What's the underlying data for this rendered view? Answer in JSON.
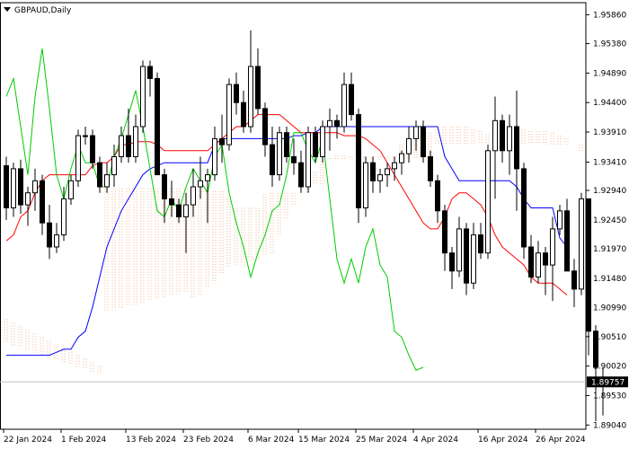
{
  "chart_data": {
    "type": "candlestick",
    "title": "GBPAUD,Daily",
    "current_price": "1.89757",
    "y_ticks": [
      "1.95860",
      "1.95380",
      "1.94890",
      "1.94400",
      "1.93910",
      "1.93410",
      "1.92940",
      "1.92450",
      "1.91970",
      "1.91480",
      "1.90990",
      "1.90510",
      "1.90020",
      "1.89530",
      "1.89040"
    ],
    "x_ticks": [
      "22 Jan 2024",
      "1 Feb 2024",
      "13 Feb 2024",
      "23 Feb 2024",
      "6 Mar 2024",
      "15 Mar 2024",
      "25 Mar 2024",
      "4 Apr 2024",
      "16 Apr 2024",
      "26 Apr 2024"
    ],
    "ylim": [
      1.8897,
      1.9606
    ],
    "grid": false,
    "colors": {
      "candle_body": "#000000",
      "candle_up_fill": "#ffffff",
      "tenkan_sen": "#ff0000",
      "kijun_sen": "#0000ff",
      "chikou_span": "#00cc00",
      "kumo": "#e8a070",
      "price_line": "#c0c0c0"
    },
    "candles": [
      [
        1.9335,
        1.935,
        1.9245,
        1.9265
      ],
      [
        1.9265,
        1.934,
        1.925,
        1.933
      ],
      [
        1.933,
        1.9345,
        1.9255,
        1.927
      ],
      [
        1.927,
        1.93,
        1.9235,
        1.929
      ],
      [
        1.929,
        1.933,
        1.926,
        1.931
      ],
      [
        1.931,
        1.932,
        1.922,
        1.924
      ],
      [
        1.924,
        1.927,
        1.918,
        1.92
      ],
      [
        1.92,
        1.924,
        1.919,
        1.922
      ],
      [
        1.922,
        1.93,
        1.921,
        1.928
      ],
      [
        1.928,
        1.932,
        1.927,
        1.931
      ],
      [
        1.931,
        1.9395,
        1.93,
        1.9385
      ],
      [
        1.9385,
        1.94,
        1.937,
        1.9385
      ],
      [
        1.9385,
        1.9395,
        1.933,
        1.934
      ],
      [
        1.934,
        1.935,
        1.929,
        1.93
      ],
      [
        1.93,
        1.934,
        1.929,
        1.932
      ],
      [
        1.932,
        1.937,
        1.93,
        1.935
      ],
      [
        1.935,
        1.94,
        1.934,
        1.9385
      ],
      [
        1.9385,
        1.943,
        1.934,
        1.935
      ],
      [
        1.935,
        1.942,
        1.934,
        1.94
      ],
      [
        1.94,
        1.951,
        1.939,
        1.95
      ],
      [
        1.95,
        1.951,
        1.945,
        1.948
      ],
      [
        1.948,
        1.949,
        1.934,
        1.932
      ],
      [
        1.932,
        1.933,
        1.924,
        1.928
      ],
      [
        1.928,
        1.931,
        1.925,
        1.927
      ],
      [
        1.927,
        1.928,
        1.924,
        1.925
      ],
      [
        1.925,
        1.929,
        1.919,
        1.927
      ],
      [
        1.927,
        1.933,
        1.925,
        1.93
      ],
      [
        1.93,
        1.935,
        1.928,
        1.931
      ],
      [
        1.931,
        1.933,
        1.924,
        1.932
      ],
      [
        1.932,
        1.94,
        1.931,
        1.938
      ],
      [
        1.938,
        1.942,
        1.934,
        1.937
      ],
      [
        1.937,
        1.948,
        1.936,
        1.947
      ],
      [
        1.947,
        1.949,
        1.942,
        1.944
      ],
      [
        1.944,
        1.946,
        1.939,
        1.94
      ],
      [
        1.94,
        1.956,
        1.939,
        1.95
      ],
      [
        1.95,
        1.953,
        1.942,
        1.943
      ],
      [
        1.943,
        1.944,
        1.935,
        1.937
      ],
      [
        1.937,
        1.94,
        1.93,
        1.932
      ],
      [
        1.932,
        1.94,
        1.931,
        1.939
      ],
      [
        1.939,
        1.94,
        1.934,
        1.935
      ],
      [
        1.935,
        1.938,
        1.932,
        1.934
      ],
      [
        1.934,
        1.936,
        1.929,
        1.93
      ],
      [
        1.93,
        1.94,
        1.929,
        1.939
      ],
      [
        1.939,
        1.94,
        1.934,
        1.935
      ],
      [
        1.935,
        1.941,
        1.934,
        1.94
      ],
      [
        1.94,
        1.943,
        1.936,
        1.941
      ],
      [
        1.941,
        1.942,
        1.938,
        1.94
      ],
      [
        1.94,
        1.949,
        1.939,
        1.947
      ],
      [
        1.947,
        1.949,
        1.941,
        1.942
      ],
      [
        1.942,
        1.943,
        1.924,
        1.9265
      ],
      [
        1.9265,
        1.935,
        1.925,
        1.934
      ],
      [
        1.934,
        1.935,
        1.929,
        1.931
      ],
      [
        1.931,
        1.933,
        1.929,
        1.932
      ],
      [
        1.932,
        1.934,
        1.93,
        1.933
      ],
      [
        1.933,
        1.935,
        1.931,
        1.934
      ],
      [
        1.934,
        1.936,
        1.932,
        1.9355
      ],
      [
        1.9355,
        1.94,
        1.934,
        1.938
      ],
      [
        1.938,
        1.941,
        1.936,
        1.94
      ],
      [
        1.94,
        1.941,
        1.934,
        1.935
      ],
      [
        1.935,
        1.936,
        1.93,
        1.931
      ],
      [
        1.931,
        1.932,
        1.924,
        1.926
      ],
      [
        1.926,
        1.927,
        1.916,
        1.919
      ],
      [
        1.919,
        1.92,
        1.913,
        1.916
      ],
      [
        1.916,
        1.925,
        1.915,
        1.923
      ],
      [
        1.923,
        1.924,
        1.912,
        1.914
      ],
      [
        1.914,
        1.924,
        1.913,
        1.922
      ],
      [
        1.922,
        1.924,
        1.918,
        1.919
      ],
      [
        1.919,
        1.937,
        1.918,
        1.936
      ],
      [
        1.936,
        1.945,
        1.928,
        1.941
      ],
      [
        1.941,
        1.942,
        1.934,
        1.936
      ],
      [
        1.936,
        1.942,
        1.932,
        1.94
      ],
      [
        1.94,
        1.946,
        1.926,
        1.933
      ],
      [
        1.933,
        1.934,
        1.918,
        1.92
      ],
      [
        1.92,
        1.922,
        1.914,
        1.915
      ],
      [
        1.915,
        1.921,
        1.914,
        1.919
      ],
      [
        1.919,
        1.92,
        1.912,
        1.917
      ],
      [
        1.917,
        1.925,
        1.911,
        1.923
      ],
      [
        1.923,
        1.927,
        1.922,
        1.926
      ],
      [
        1.926,
        1.928,
        1.916,
        1.916
      ],
      [
        1.916,
        1.918,
        1.91,
        1.913
      ],
      [
        1.913,
        1.929,
        1.912,
        1.928
      ],
      [
        1.928,
        1.925,
        1.902,
        1.906
      ],
      [
        1.906,
        1.907,
        1.891,
        1.9
      ],
      [
        1.897,
        1.9,
        1.892,
        1.8977
      ]
    ],
    "tenkan_sen": [
      1.921,
      1.922,
      1.925,
      1.926,
      1.929,
      1.931,
      1.932,
      1.932,
      1.932,
      1.932,
      1.932,
      1.932,
      1.9335,
      1.934,
      1.934,
      1.935,
      1.937,
      1.937,
      1.9375,
      1.9375,
      1.9375,
      1.937,
      1.936,
      1.936,
      1.936,
      1.936,
      1.936,
      1.936,
      1.936,
      1.937,
      1.938,
      1.939,
      1.94,
      1.94,
      1.941,
      1.942,
      1.942,
      1.942,
      1.942,
      1.941,
      1.94,
      1.939,
      1.939,
      1.939,
      1.939,
      1.939,
      1.939,
      1.9385,
      1.9385,
      1.9385,
      1.938,
      1.937,
      1.936,
      1.934,
      1.932,
      1.93,
      1.928,
      1.926,
      1.924,
      1.923,
      1.923,
      1.925,
      1.928,
      1.929,
      1.929,
      1.928,
      1.927,
      1.925,
      1.922,
      1.92,
      1.919,
      1.918,
      1.917,
      1.915,
      1.914,
      1.914,
      1.914,
      1.913,
      1.912
    ],
    "kijun_sen": [
      1.902,
      1.902,
      1.902,
      1.902,
      1.902,
      1.902,
      1.902,
      1.9025,
      1.903,
      1.903,
      1.905,
      1.906,
      1.91,
      1.915,
      1.92,
      1.923,
      1.926,
      1.928,
      1.93,
      1.932,
      1.933,
      1.9335,
      1.934,
      1.934,
      1.934,
      1.934,
      1.934,
      1.934,
      1.934,
      1.937,
      1.938,
      1.938,
      1.938,
      1.938,
      1.938,
      1.938,
      1.938,
      1.938,
      1.938,
      1.938,
      1.9385,
      1.9385,
      1.939,
      1.939,
      1.94,
      1.94,
      1.94,
      1.94,
      1.94,
      1.94,
      1.94,
      1.94,
      1.94,
      1.94,
      1.94,
      1.94,
      1.94,
      1.94,
      1.94,
      1.94,
      1.94,
      1.935,
      1.933,
      1.931,
      1.931,
      1.931,
      1.931,
      1.931,
      1.931,
      1.931,
      1.931,
      1.93,
      1.928,
      1.9265,
      1.9265,
      1.9265,
      1.9265,
      1.9215,
      1.92
    ],
    "chikou_span": [
      1.945,
      1.948,
      1.94,
      1.932,
      1.945,
      1.953,
      1.943,
      1.932,
      1.928,
      1.933,
      1.937,
      1.934,
      1.934,
      1.93,
      1.93,
      1.935,
      1.938,
      1.942,
      1.946,
      1.94,
      1.933,
      1.926,
      1.925,
      1.928,
      1.926,
      1.93,
      1.933,
      1.931,
      1.929,
      1.935,
      1.937,
      1.929,
      1.924,
      1.92,
      1.915,
      1.919,
      1.922,
      1.926,
      1.927,
      1.932,
      1.939,
      1.939,
      1.936,
      1.934,
      1.938,
      1.928,
      1.918,
      1.914,
      1.918,
      1.914,
      1.92,
      1.923,
      1.917,
      1.915,
      1.906,
      1.905,
      1.902,
      1.8995,
      1.9
    ]
  }
}
